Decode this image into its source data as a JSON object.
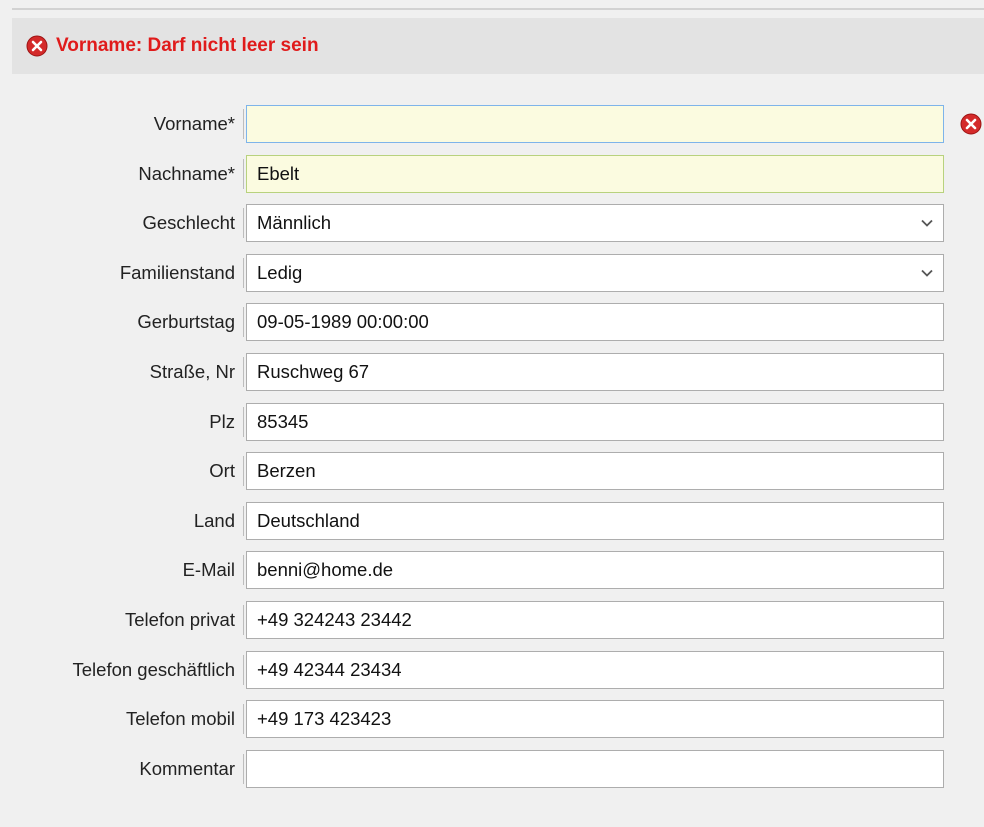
{
  "colors": {
    "error": "#e01b1b",
    "required_bg": "#fbfbe0",
    "focus_border": "#7eb4ea",
    "banner_bg": "#e3e3e3"
  },
  "error_banner": {
    "icon": "error-x-circle-icon",
    "message": "Vorname: Darf nicht leer sein"
  },
  "form": {
    "fields": [
      {
        "label": "Vorname*",
        "value": "",
        "type": "text",
        "required": true,
        "focused": true,
        "error": true
      },
      {
        "label": "Nachname*",
        "value": "Ebelt",
        "type": "text",
        "required": true
      },
      {
        "label": "Geschlecht",
        "value": "Männlich",
        "type": "select"
      },
      {
        "label": "Familienstand",
        "value": "Ledig",
        "type": "select"
      },
      {
        "label": "Gerburtstag",
        "value": "09-05-1989 00:00:00",
        "type": "text"
      },
      {
        "label": "Straße, Nr",
        "value": "Ruschweg 67",
        "type": "text"
      },
      {
        "label": "Plz",
        "value": "85345",
        "type": "text"
      },
      {
        "label": "Ort",
        "value": "Berzen",
        "type": "text"
      },
      {
        "label": "Land",
        "value": "Deutschland",
        "type": "text"
      },
      {
        "label": "E-Mail",
        "value": "benni@home.de",
        "type": "text"
      },
      {
        "label": "Telefon privat",
        "value": "+49 324243 23442",
        "type": "text"
      },
      {
        "label": "Telefon geschäftlich",
        "value": "+49 42344 23434",
        "type": "text"
      },
      {
        "label": "Telefon mobil",
        "value": "+49 173 423423",
        "type": "text"
      },
      {
        "label": "Kommentar",
        "value": "",
        "type": "text"
      }
    ]
  }
}
